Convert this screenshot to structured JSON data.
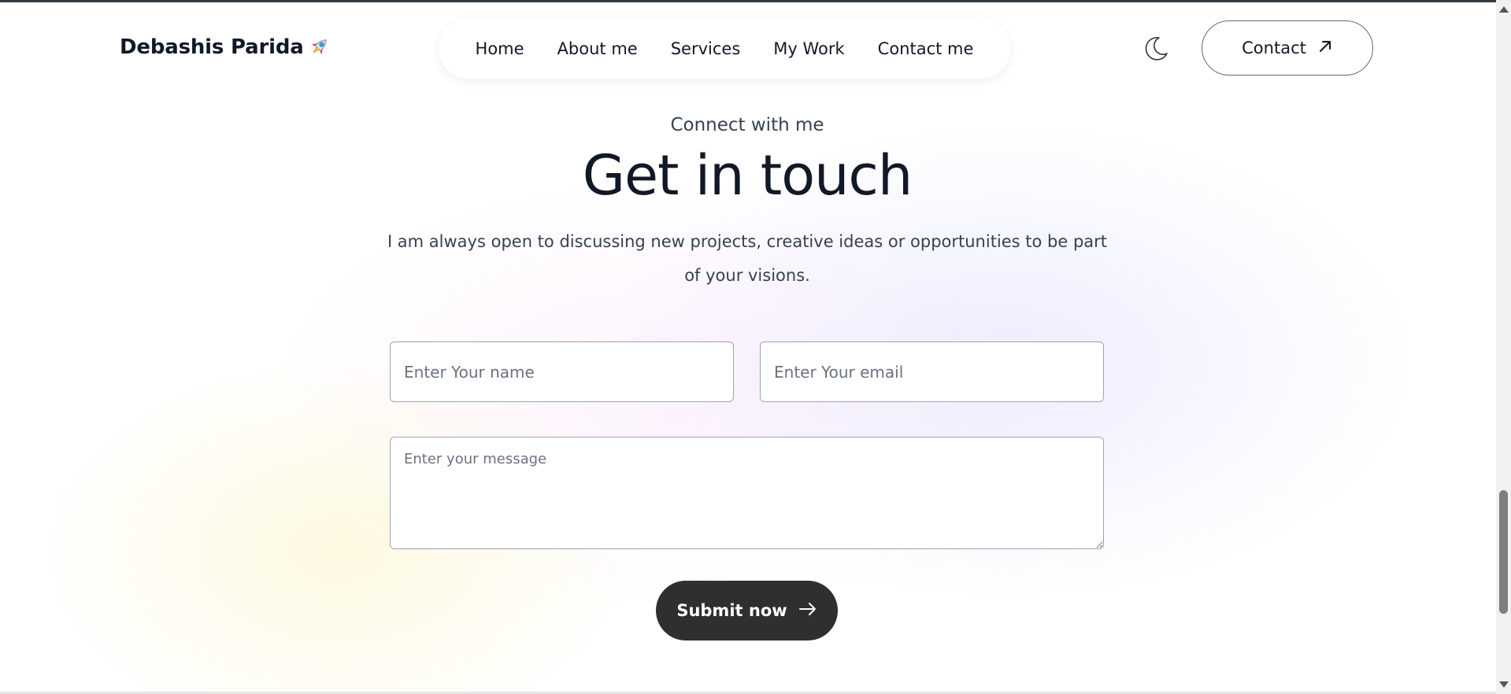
{
  "header": {
    "logo_text": "Debashis Parida",
    "logo_icon": "rocket-icon",
    "nav": [
      {
        "label": "Home"
      },
      {
        "label": "About me"
      },
      {
        "label": "Services"
      },
      {
        "label": "My Work"
      },
      {
        "label": "Contact me"
      }
    ],
    "theme_icon": "moon-icon",
    "contact_label": "Contact",
    "contact_icon": "arrow-up-right-icon"
  },
  "section": {
    "subtitle": "Connect with me",
    "title": "Get in touch",
    "description": "I am always open to discussing new projects, creative ideas or opportunities to be part of your visions."
  },
  "form": {
    "name_placeholder": "Enter Your name",
    "email_placeholder": "Enter Your email",
    "message_placeholder": "Enter your message",
    "submit_label": "Submit now",
    "submit_icon": "arrow-right-icon"
  },
  "colors": {
    "text": "#111827",
    "muted": "#374151",
    "button_bg": "#2f2f2f",
    "border": "#9ca3af"
  }
}
